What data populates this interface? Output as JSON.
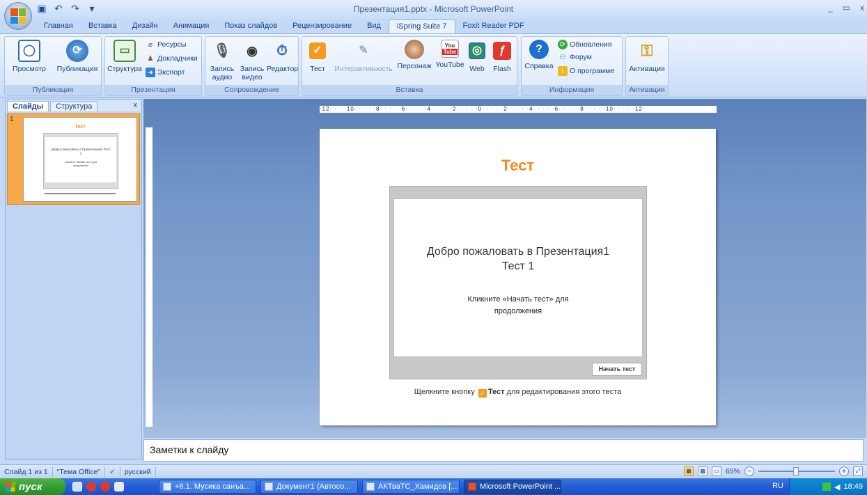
{
  "window": {
    "title": "Презентация1.pptx - Microsoft PowerPoint",
    "controls": [
      "_",
      "▭",
      "x"
    ]
  },
  "tabs": [
    {
      "label": "Главная",
      "active": false
    },
    {
      "label": "Вставка",
      "active": false
    },
    {
      "label": "Дизайн",
      "active": false
    },
    {
      "label": "Анимация",
      "active": false
    },
    {
      "label": "Показ слайдов",
      "active": false
    },
    {
      "label": "Рецензирование",
      "active": false
    },
    {
      "label": "Вид",
      "active": false
    },
    {
      "label": "iSpring Suite 7",
      "active": true
    },
    {
      "label": "Foxit Reader PDF",
      "active": false
    }
  ],
  "ribbon": {
    "publication": {
      "label": "Публикация",
      "preview": "Просмотр",
      "publish": "Публикация"
    },
    "presentation": {
      "label": "Презентация",
      "structure": "Структура",
      "resources": "Ресурсы",
      "speakers": "Докладчики",
      "export": "Экспорт"
    },
    "narration": {
      "label": "Сопровождение",
      "record_audio_1": "Запись",
      "record_audio_2": "аудио",
      "record_video_1": "Запись",
      "record_video_2": "видео",
      "editor": "Редактор"
    },
    "insert": {
      "label": "Вставка",
      "quiz": "Тест",
      "interaction": "Интерактивность",
      "character": "Персонаж",
      "youtube": "YouTube",
      "youtube_icon_top": "You",
      "youtube_icon_bottom": "Tube",
      "web": "Web",
      "flash": "Flash"
    },
    "info": {
      "label": "Информация",
      "help": "Справка",
      "updates": "Обновления",
      "forum": "Форум",
      "about": "О программе"
    },
    "activation": {
      "label": "Активация",
      "activate": "Активация"
    }
  },
  "left_pane": {
    "tab_slides": "Слайды",
    "tab_outline": "Структура",
    "close": "x",
    "slide_number": "1",
    "thumb_title": "Тест",
    "thumb_heading": "Добро пожаловать в Презентация1 Тест 1",
    "thumb_sub": "Кликните «Начать тест» для продолжения"
  },
  "ruler": {
    "text": "·12· · · ·10· · · · ·8· · · · ·6· · · · ·4· · · · ·2· · · · ·0· · · · ·2· · · · ·4· · · · ·6· · · · ·8· · · · ·10· · · · ·12·"
  },
  "slide": {
    "title": "Тест",
    "heading_line1": "Добро пожаловать в Презентация1",
    "heading_line2": "Тест 1",
    "sub_text": "Кликните «Начать тест» для продолжения",
    "start_button": "Начать тест",
    "footer_before": "Щелкните кнопку",
    "footer_bold": "Тест",
    "footer_after": "для редактирования этого теста"
  },
  "notes": {
    "placeholder": "Заметки к слайду"
  },
  "status": {
    "slide_info": "Слайд 1 из 1",
    "theme": "\"Тема Office\"",
    "language": "русский",
    "zoom": "65%"
  },
  "taskbar": {
    "start": "пуск",
    "tasks": [
      {
        "label": "+6.1. Мусика санъа...",
        "active": false
      },
      {
        "label": "Документ1 (Автосо...",
        "active": false
      },
      {
        "label": "АКТваТС_Хамидов [...",
        "active": false
      },
      {
        "label": "Microsoft PowerPoint ...",
        "active": true
      }
    ],
    "lang": "RU",
    "clock": "18:49"
  },
  "colors": {
    "accent_orange": "#f28a1f",
    "ribbon_blue": "#15428b",
    "taskbar_blue": "#245edb",
    "start_green": "#3a9d3a"
  }
}
